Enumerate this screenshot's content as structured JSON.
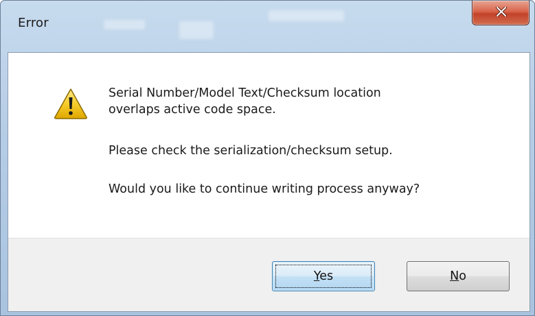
{
  "window": {
    "title": "Error",
    "close_label": "x"
  },
  "message": {
    "line1": "Serial Number/Model Text/Checksum location",
    "line2": "overlaps active code space.",
    "line3": "Please check the serialization/checksum setup.",
    "line4": "Would you like to continue writing process anyway?"
  },
  "buttons": {
    "yes": {
      "access_key": "Y",
      "rest": "es"
    },
    "no": {
      "access_key": "N",
      "rest": "o"
    }
  },
  "icons": {
    "dialog": "warning-icon",
    "close": "close-icon"
  },
  "colors": {
    "close_button": "#c2432a",
    "warning_yellow": "#f4c430"
  }
}
